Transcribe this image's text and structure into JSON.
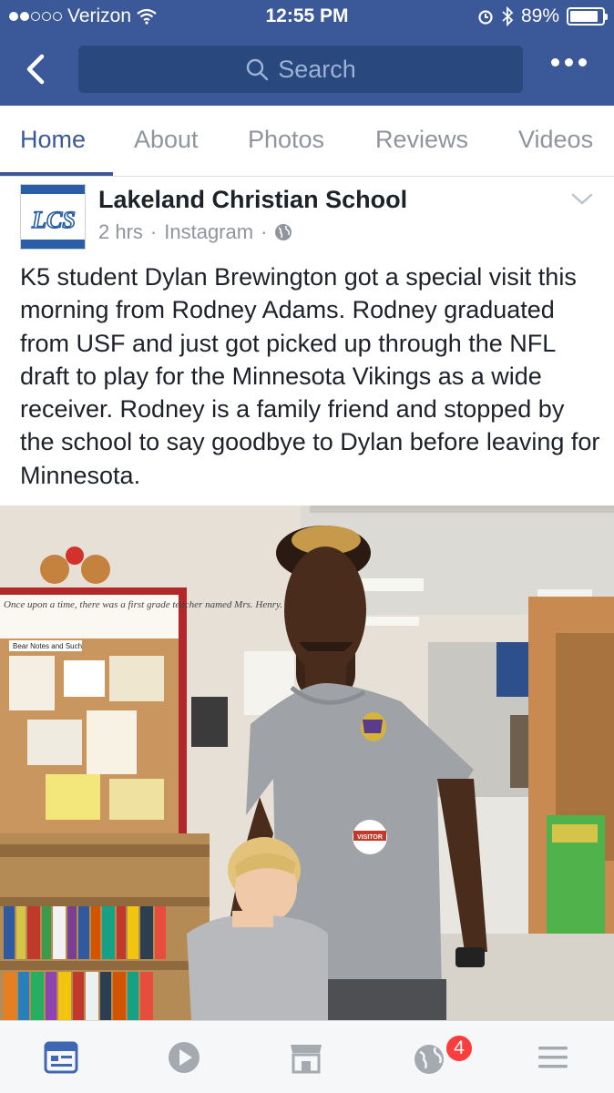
{
  "status_bar": {
    "carrier": "Verizon",
    "time": "12:55 PM",
    "battery": "89%",
    "battery_level": 0.89
  },
  "nav": {
    "search_placeholder": "Search"
  },
  "tabs": [
    {
      "label": "Home",
      "active": true
    },
    {
      "label": "About",
      "active": false
    },
    {
      "label": "Photos",
      "active": false
    },
    {
      "label": "Reviews",
      "active": false
    },
    {
      "label": "Videos",
      "active": false
    }
  ],
  "post": {
    "page_name": "Lakeland Christian School",
    "logo_text": "LCS",
    "time": "2 hrs",
    "separator": "·",
    "source": "Instagram",
    "text": "K5 student Dylan Brewington got a special visit this morning from Rodney Adams. Rodney graduated from USF and just got picked up through the NFL draft to play for the Minnesota Vikings as a wide receiver. Rodney is a family friend and stopped by the school to say goodbye to Dylan before leaving for Minnesota."
  },
  "photo": {
    "board_text": "Once upon a time, there was a first grade teacher named Mrs. Henry. We thought she was",
    "bear_notes": "Bear Notes and Such",
    "sticker": "VISITOR"
  },
  "bottom_bar": {
    "notification_count": "4"
  },
  "colors": {
    "brand": "#3b5998",
    "search_bg": "#29487d",
    "badge": "#fa3e3e"
  }
}
